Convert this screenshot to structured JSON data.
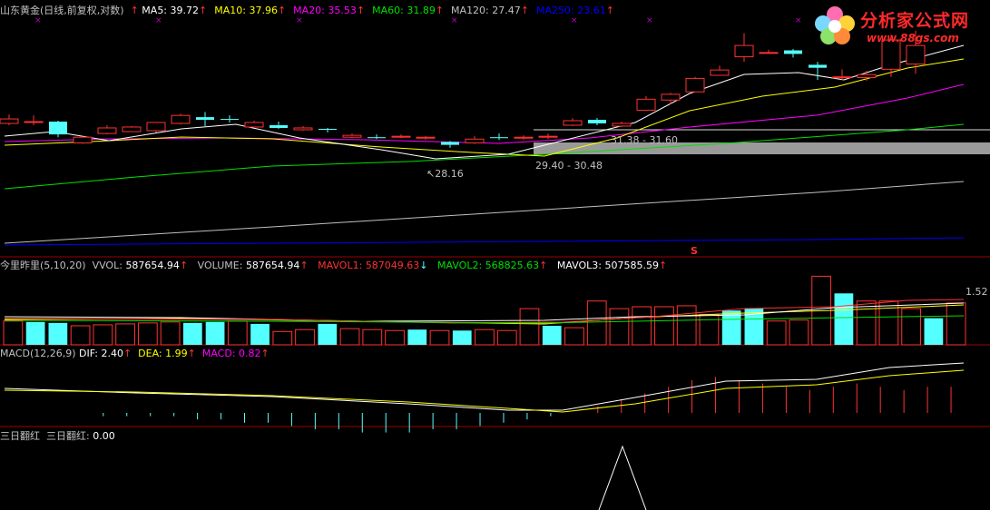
{
  "colors": {
    "background": "#000000",
    "up_candle": "#ff3232",
    "down_candle": "#54ffff",
    "ma5": "#ffffff",
    "ma10": "#ffff00",
    "ma20": "#ff00ff",
    "ma60": "#00e000",
    "ma120": "#c0c0c0",
    "ma250": "#0000ff",
    "panel_border": "#a00000"
  },
  "main_panel": {
    "title": "山东黄金(日线,前复权,对数)",
    "indicators": [
      {
        "label": "MA5:",
        "value": "39.72",
        "arrow": "↑",
        "color": "#ffffff"
      },
      {
        "label": "MA10:",
        "value": "37.96",
        "arrow": "↑",
        "color": "#ffff00"
      },
      {
        "label": "MA20:",
        "value": "35.53",
        "arrow": "↑",
        "color": "#ff00ff"
      },
      {
        "label": "MA60:",
        "value": "31.89",
        "arrow": "↑",
        "color": "#00e000"
      },
      {
        "label": "MA120:",
        "value": "27.47",
        "arrow": "↑",
        "color": "#c0c0c0"
      },
      {
        "label": "MA250:",
        "value": "23.61",
        "arrow": "↑",
        "color": "#0000ff"
      }
    ],
    "annotation_low": "28.16",
    "annotation_range1": "31.38 - 31.60",
    "annotation_range2": "29.40 - 30.48",
    "marker_s": "S"
  },
  "logo": {
    "name": "分析家公式网",
    "url": "www.88gs.com"
  },
  "volume_panel": {
    "title": "今里昨里(5,10,20)",
    "vvol_label": "VVOL:",
    "vvol_value": "587654.94",
    "volume_label": "VOLUME:",
    "volume_value": "587654.94",
    "mavol1_label": "MAVOL1:",
    "mavol1_value": "587049.63",
    "mavol2_label": "MAVOL2:",
    "mavol2_value": "568825.63",
    "mavol3_label": "MAVOL3:",
    "mavol3_value": "507585.59",
    "right_value": "1.52"
  },
  "macd_panel": {
    "title": "MACD(12,26,9)",
    "dif_label": "DIF:",
    "dif_value": "2.40",
    "dea_label": "DEA:",
    "dea_value": "1.99",
    "macd_label": "MACD:",
    "macd_value": "0.82"
  },
  "signal_panel": {
    "title": "三日翻红",
    "label": "三日翻红:",
    "value": "0.00"
  },
  "chart_data": {
    "type": "candlestick",
    "candles": [
      {
        "o": 33.1,
        "c": 33.6,
        "h": 34.1,
        "l": 32.9,
        "up": true
      },
      {
        "o": 33.3,
        "c": 33.3,
        "h": 34.0,
        "l": 32.9,
        "up": true
      },
      {
        "o": 33.3,
        "c": 31.9,
        "h": 33.4,
        "l": 31.6,
        "up": false
      },
      {
        "o": 31.0,
        "c": 31.6,
        "h": 31.7,
        "l": 30.9,
        "up": true
      },
      {
        "o": 32.0,
        "c": 32.6,
        "h": 32.9,
        "l": 31.9,
        "up": true
      },
      {
        "o": 32.2,
        "c": 32.7,
        "h": 32.8,
        "l": 32.2,
        "up": true
      },
      {
        "o": 32.3,
        "c": 33.2,
        "h": 33.2,
        "l": 32.1,
        "up": true
      },
      {
        "o": 33.1,
        "c": 34.0,
        "h": 34.2,
        "l": 33.0,
        "up": true
      },
      {
        "o": 33.8,
        "c": 33.5,
        "h": 34.4,
        "l": 32.8,
        "up": false
      },
      {
        "o": 33.6,
        "c": 33.6,
        "h": 34.0,
        "l": 33.2,
        "up": false
      },
      {
        "o": 32.7,
        "c": 33.2,
        "h": 33.4,
        "l": 32.6,
        "up": true
      },
      {
        "o": 32.9,
        "c": 32.6,
        "h": 33.3,
        "l": 32.5,
        "up": false
      },
      {
        "o": 32.4,
        "c": 32.6,
        "h": 32.8,
        "l": 32.3,
        "up": true
      },
      {
        "o": 32.5,
        "c": 32.4,
        "h": 32.6,
        "l": 32.1,
        "up": false
      },
      {
        "o": 31.6,
        "c": 31.8,
        "h": 32.0,
        "l": 31.5,
        "up": true
      },
      {
        "o": 31.6,
        "c": 31.5,
        "h": 31.9,
        "l": 31.4,
        "up": false
      },
      {
        "o": 31.7,
        "c": 31.6,
        "h": 31.9,
        "l": 31.5,
        "up": true
      },
      {
        "o": 31.5,
        "c": 31.6,
        "h": 31.7,
        "l": 31.3,
        "up": true
      },
      {
        "o": 31.1,
        "c": 30.8,
        "h": 31.2,
        "l": 30.5,
        "up": false
      },
      {
        "o": 31.0,
        "c": 31.4,
        "h": 31.7,
        "l": 30.9,
        "up": true
      },
      {
        "o": 31.6,
        "c": 31.5,
        "h": 32.0,
        "l": 31.3,
        "up": false
      },
      {
        "o": 31.5,
        "c": 31.6,
        "h": 31.8,
        "l": 31.3,
        "up": true
      },
      {
        "o": 31.6,
        "c": 31.7,
        "h": 32.0,
        "l": 31.4,
        "up": true
      },
      {
        "o": 32.9,
        "c": 33.4,
        "h": 33.7,
        "l": 32.8,
        "up": true
      },
      {
        "o": 33.5,
        "c": 33.1,
        "h": 33.7,
        "l": 32.9,
        "up": false
      },
      {
        "o": 32.8,
        "c": 33.1,
        "h": 33.3,
        "l": 32.7,
        "up": true
      },
      {
        "o": 34.6,
        "c": 35.9,
        "h": 36.3,
        "l": 34.6,
        "up": true
      },
      {
        "o": 35.8,
        "c": 36.5,
        "h": 36.7,
        "l": 35.3,
        "up": true
      },
      {
        "o": 36.8,
        "c": 38.5,
        "h": 38.7,
        "l": 36.8,
        "up": true
      },
      {
        "o": 38.9,
        "c": 39.6,
        "h": 40.2,
        "l": 38.9,
        "up": true
      },
      {
        "o": 41.4,
        "c": 43.0,
        "h": 44.8,
        "l": 40.7,
        "up": true
      },
      {
        "o": 41.9,
        "c": 42.0,
        "h": 42.4,
        "l": 41.8,
        "up": true
      },
      {
        "o": 42.3,
        "c": 41.8,
        "h": 42.5,
        "l": 41.3,
        "up": false
      },
      {
        "o": 40.3,
        "c": 39.9,
        "h": 40.7,
        "l": 38.3,
        "up": false
      },
      {
        "o": 38.6,
        "c": 38.7,
        "h": 39.7,
        "l": 38.3,
        "up": true
      },
      {
        "o": 38.6,
        "c": 39.0,
        "h": 39.5,
        "l": 38.2,
        "up": true
      },
      {
        "o": 39.7,
        "c": 43.8,
        "h": 44.6,
        "l": 38.7,
        "up": true
      },
      {
        "o": 40.4,
        "c": 43.0,
        "h": 45.2,
        "l": 39.1,
        "up": true
      }
    ],
    "volume": [
      {
        "v": 25,
        "up": true
      },
      {
        "v": 24,
        "up": false
      },
      {
        "v": 23,
        "up": false
      },
      {
        "v": 20,
        "up": true
      },
      {
        "v": 21,
        "up": true
      },
      {
        "v": 22,
        "up": true
      },
      {
        "v": 23,
        "up": true
      },
      {
        "v": 24,
        "up": true
      },
      {
        "v": 23,
        "up": false
      },
      {
        "v": 24,
        "up": false
      },
      {
        "v": 25,
        "up": true
      },
      {
        "v": 22,
        "up": false
      },
      {
        "v": 14,
        "up": true
      },
      {
        "v": 16,
        "up": true
      },
      {
        "v": 22,
        "up": false
      },
      {
        "v": 17,
        "up": true
      },
      {
        "v": 16,
        "up": true
      },
      {
        "v": 15,
        "up": true
      },
      {
        "v": 16,
        "up": false
      },
      {
        "v": 15,
        "up": true
      },
      {
        "v": 15,
        "up": false
      },
      {
        "v": 16,
        "up": true
      },
      {
        "v": 15,
        "up": true
      },
      {
        "v": 38,
        "up": true
      },
      {
        "v": 20,
        "up": false
      },
      {
        "v": 18,
        "up": true
      },
      {
        "v": 46,
        "up": true
      },
      {
        "v": 38,
        "up": true
      },
      {
        "v": 40,
        "up": true
      },
      {
        "v": 40,
        "up": true
      },
      {
        "v": 41,
        "up": true
      },
      {
        "v": 32,
        "up": true
      },
      {
        "v": 36,
        "up": false
      },
      {
        "v": 38,
        "up": false
      },
      {
        "v": 25,
        "up": true
      },
      {
        "v": 26,
        "up": true
      },
      {
        "v": 72,
        "up": true
      },
      {
        "v": 54,
        "up": false
      },
      {
        "v": 46,
        "up": true
      },
      {
        "v": 46,
        "up": true
      },
      {
        "v": 38,
        "up": true
      },
      {
        "v": 28,
        "up": false
      },
      {
        "v": 44,
        "up": true
      }
    ],
    "macd_hist": [
      0,
      0,
      0,
      0,
      -1,
      -1,
      -1,
      -1,
      -2,
      -2,
      -3,
      -3,
      -4,
      -5,
      -5,
      -6,
      -6,
      -6,
      -5,
      -5,
      -4,
      -3,
      -2,
      -1,
      0,
      2,
      4,
      6,
      8,
      10,
      11,
      10,
      9,
      8,
      7,
      8,
      9,
      8,
      7,
      8,
      8
    ],
    "signal_peak": 1.0
  }
}
